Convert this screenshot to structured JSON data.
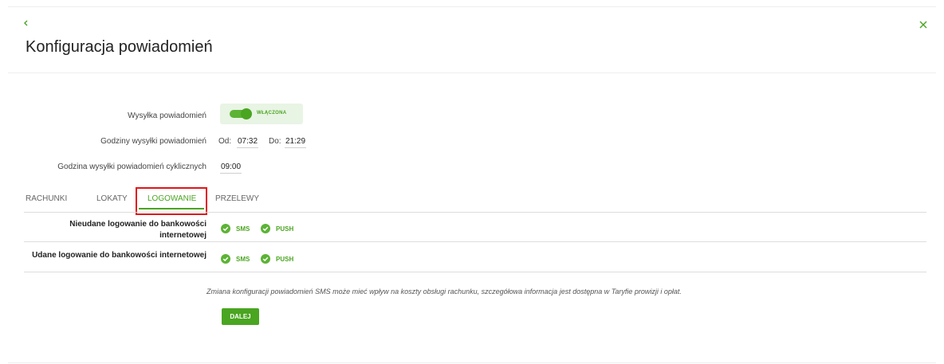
{
  "header": {
    "back_icon": "chevron-left-icon",
    "close_icon": "close-icon",
    "title": "Konfiguracja powiadomień"
  },
  "settings": {
    "sending_label": "Wysyłka powiadomień",
    "toggle_state_text": "WŁĄCZONA",
    "toggle_on": true,
    "hours_label": "Godziny wysyłki powiadomień",
    "from_label": "Od:",
    "from_value": "07:32",
    "to_label": "Do:",
    "to_value": "21:29",
    "cyclic_label": "Godzina wysyłki powiadomień cyklicznych",
    "cyclic_value": "09:00"
  },
  "tabs": [
    {
      "label": "RACHUNKI",
      "active": false
    },
    {
      "label": "LOKATY",
      "active": false
    },
    {
      "label": "LOGOWANIE",
      "active": true
    },
    {
      "label": "PRZELEWY",
      "active": false
    }
  ],
  "options": [
    {
      "label": "Nieudane logowanie do bankowości internetowej",
      "sms_label": "SMS",
      "sms_checked": true,
      "push_label": "PUSH",
      "push_checked": true
    },
    {
      "label": "Udane logowanie do bankowości internetowej",
      "sms_label": "SMS",
      "sms_checked": true,
      "push_label": "PUSH",
      "push_checked": true
    }
  ],
  "note": "Zmiana konfiguracji powiadomień SMS może mieć wpływ na koszty obsługi rachunku, szczegółowa informacja jest dostępna w Taryfie prowizji i opłat.",
  "next_button": "DALEJ",
  "colors": {
    "accent": "#4aa521",
    "accent_light": "#e8f4e4",
    "highlight": "#e0161b"
  }
}
